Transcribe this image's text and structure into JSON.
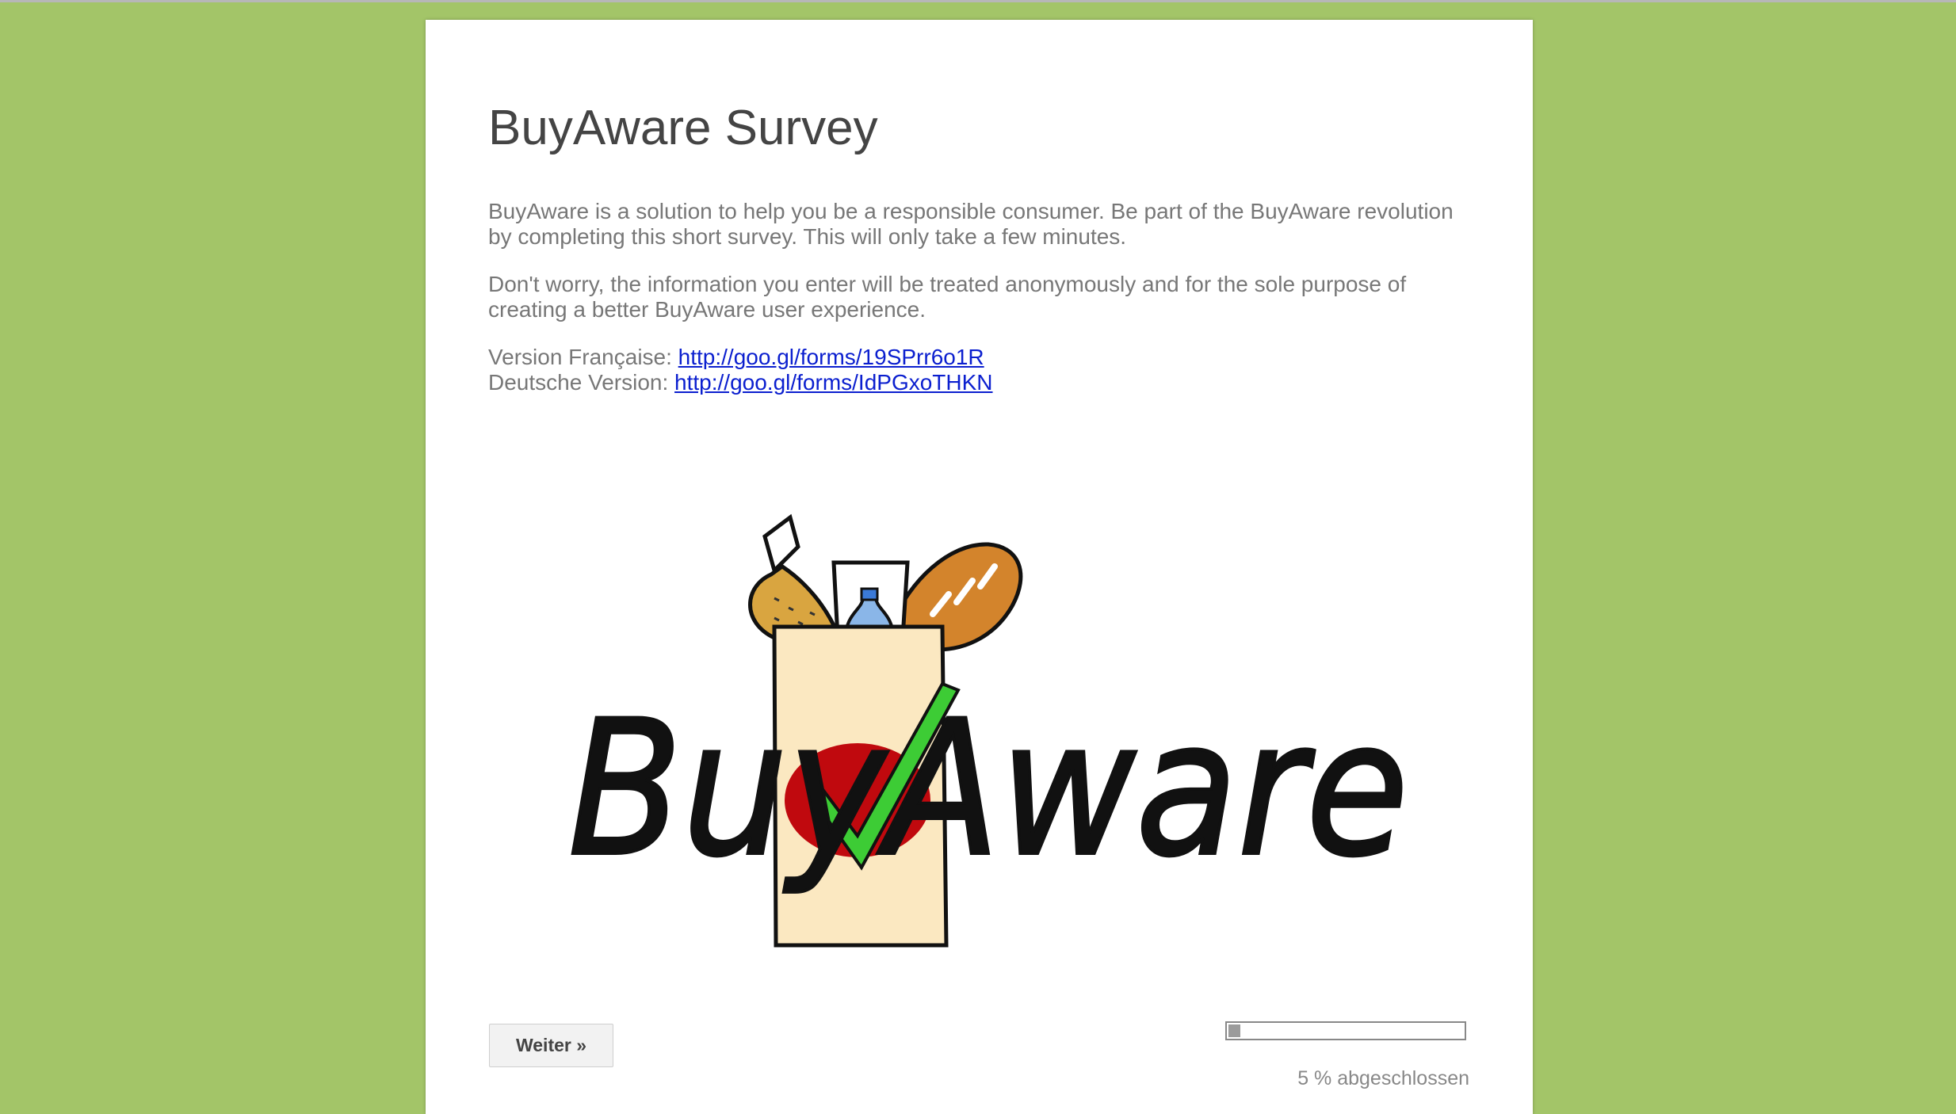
{
  "survey": {
    "title": "BuyAware Survey",
    "intro": "BuyAware is a solution to help you be a responsible consumer. Be part of the BuyAware revolution by completing this short survey. This will only take a few minutes.",
    "privacy": "Don't worry, the information you enter will be treated anonymously and for the sole purpose of creating a better BuyAware user experience.",
    "versions": {
      "french_label": "Version Française: ",
      "french_link": "http://goo.gl/forms/19SPrr6o1R",
      "german_label": "Deutsche Version: ",
      "german_link": "http://goo.gl/forms/IdPGxoTHKN"
    },
    "logo_text": "BuyAware"
  },
  "navigation": {
    "next_label": "Weiter »"
  },
  "progress": {
    "percent": 5,
    "label": "5 % abgeschlossen"
  },
  "colors": {
    "background": "#a3c568",
    "card": "#ffffff",
    "link": "#0b1fcf",
    "check": "#3dcc35",
    "oval": "#c0090e",
    "bag": "#fbe8c1"
  }
}
